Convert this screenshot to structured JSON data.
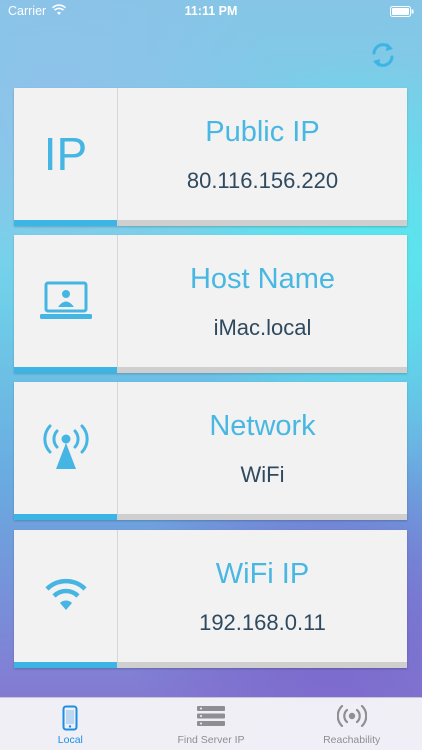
{
  "status_bar": {
    "carrier": "Carrier",
    "time": "11:11 PM"
  },
  "cards": [
    {
      "icon": "ip-glyph",
      "icon_text": "IP",
      "title": "Public IP",
      "value": "80.116.156.220"
    },
    {
      "icon": "laptop-user-icon",
      "title": "Host Name",
      "value": "iMac.local"
    },
    {
      "icon": "antenna-icon",
      "title": "Network",
      "value": "WiFi"
    },
    {
      "icon": "wifi-icon",
      "title": "WiFi IP",
      "value": "192.168.0.11"
    }
  ],
  "tabs": [
    {
      "label": "Local",
      "icon": "phone-icon",
      "active": true
    },
    {
      "label": "Find Server IP",
      "icon": "server-icon",
      "active": false
    },
    {
      "label": "Reachability",
      "icon": "broadcast-icon",
      "active": false
    }
  ],
  "colors": {
    "accent": "#48b8e3",
    "value_text": "#2f4a5f",
    "tab_active": "#1a8fe6"
  }
}
